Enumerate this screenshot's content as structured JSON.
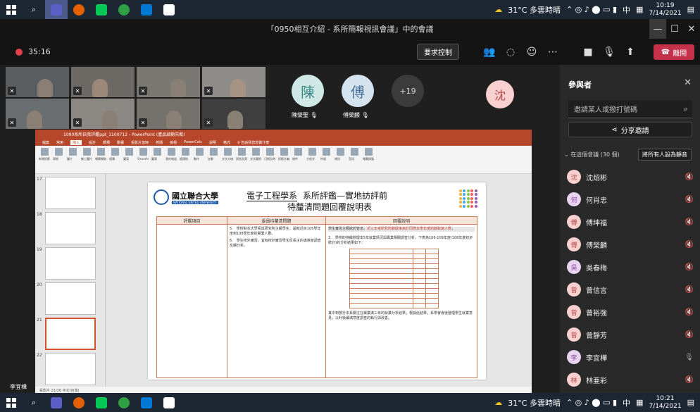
{
  "taskbar_top": {
    "weather": "31°C 多雲時晴",
    "time": "10:19",
    "date": "7/14/2021",
    "ime": "中"
  },
  "taskbar_bottom": {
    "weather": "31°C 多雲時晴",
    "time": "10:21",
    "date": "7/14/2021",
    "ime": "中"
  },
  "window": {
    "title": "「0950相互介紹 - 系所簡報視訊會議」中的會議"
  },
  "meeting": {
    "timer": "35:16",
    "request_control": "要求控制",
    "leave": "離開"
  },
  "video_tiles": [],
  "avatars": [
    {
      "initial": "陳",
      "name": "陳榮聖",
      "color": "#cfe8e6",
      "text_color": "#3a8a86"
    },
    {
      "initial": "傅",
      "name": "傅榮麟",
      "color": "#d5e3ef",
      "text_color": "#4a7399"
    },
    {
      "initial": "+19",
      "name": "",
      "color": "#3b3b3b",
      "text_color": "#ddd"
    },
    {
      "initial": "沈",
      "name": "",
      "color": "#f7d0cf",
      "text_color": "#b34746"
    }
  ],
  "self_label": "李宜樺",
  "ppt": {
    "title_bar": "1090系所自我評鑑ppt_1100712 - PowerPoint (產品啟動失敗)",
    "tabs": [
      "檔案",
      "常用",
      "插入",
      "設計",
      "轉場",
      "動畫",
      "投影片放映",
      "校閱",
      "檢視",
      "PowerCalc",
      "說明",
      "格式",
      "♀ 告訴我您想做什麼"
    ],
    "active_tab": "插入",
    "ribbon_groups": [
      "新增投影片",
      "表格",
      "圖片",
      "線上圖片",
      "螢幕擷取畫面",
      "相簿",
      "圖案",
      "SmartArt",
      "圖表",
      "我的增益集",
      "超連結",
      "動作",
      "註解",
      "文字方塊",
      "頁首及頁尾",
      "文字藝術師",
      "日期及時間",
      "投影片編號",
      "物件",
      "方程式",
      "符號",
      "視訊",
      "音訊",
      "螢幕錄製"
    ],
    "thumb_numbers": [
      "17",
      "18",
      "19",
      "20",
      "21",
      "22"
    ],
    "status": "投影片 21/26 中文(台灣)"
  },
  "slide": {
    "university": "國立聯合大學",
    "university_en": "NATIONAL UNITED UNIVERSITY",
    "dept": "電子工程學系",
    "title_rest": "系所評鑑—實地訪評前",
    "subtitle": "待釐清問題回覆說明表",
    "col1": "評鑑項目",
    "col2": "委員待釐清問題",
    "col3": "回覆說明",
    "q5": "5.　學校對本大學系與研究所主級學生，是較近目105學年度到108學年度的畢業人數。",
    "q6": "6.　學生校外實習，宜有校外實習學生反系主的滿意度調查反饋分析。",
    "a_hl_pre": "學生實習主類狀的管道。",
    "a_hl_red": "近三年考研究所錄取率高於同儕本學年度的錄取總人數",
    "a_hl_post": "，",
    "a3": "3.　學校的持續辦理本5年就業情況與專業相關調查分析。下表為106-109年度(108年度初步統計)的分析結果如下：",
    "a_foot": "其中到部分本系關注在畢業滿三年的就業分析結果，根據此結果，系學會會後整理學生就業意見，以利後續滿意度調查的執行與改善。"
  },
  "participants_panel": {
    "title": "參與者",
    "search_placeholder": "邀請某人或撥打號碼",
    "share_invite": "分享邀請",
    "section": "在這個會議 (30 個)",
    "mute_all": "將所有人設為靜音",
    "people": [
      {
        "initial": "沈",
        "name": "沈炤彬",
        "color": "#f7d0cf",
        "text_color": "#b34746"
      },
      {
        "initial": "何",
        "name": "何肖忠",
        "color": "#e8d3f0",
        "text_color": "#8d4fa3"
      },
      {
        "initial": "傅",
        "name": "傅坤福",
        "color": "#f7d0cf",
        "text_color": "#b34746"
      },
      {
        "initial": "傅",
        "name": "傅榮麟",
        "color": "#f7d0cf",
        "text_color": "#b34746"
      },
      {
        "initial": "吳",
        "name": "吳春梅",
        "color": "#e8d3f0",
        "text_color": "#8d4fa3"
      },
      {
        "initial": "曾",
        "name": "曾信言",
        "color": "#f7d0cf",
        "text_color": "#b34746"
      },
      {
        "initial": "曾",
        "name": "曾裕強",
        "color": "#f7d0cf",
        "text_color": "#b34746"
      },
      {
        "initial": "曾",
        "name": "曾靜芳",
        "color": "#f7d0cf",
        "text_color": "#b34746"
      },
      {
        "initial": "李",
        "name": "李宜樺",
        "color": "#e8d3f0",
        "text_color": "#8d4fa3"
      },
      {
        "initial": "林",
        "name": "林亜彩",
        "color": "#f7d0cf",
        "text_color": "#b34746"
      }
    ]
  },
  "colors": {
    "accent_red": "#c4314b",
    "ppt_orange": "#b7472a",
    "panel_bg": "#292929"
  }
}
